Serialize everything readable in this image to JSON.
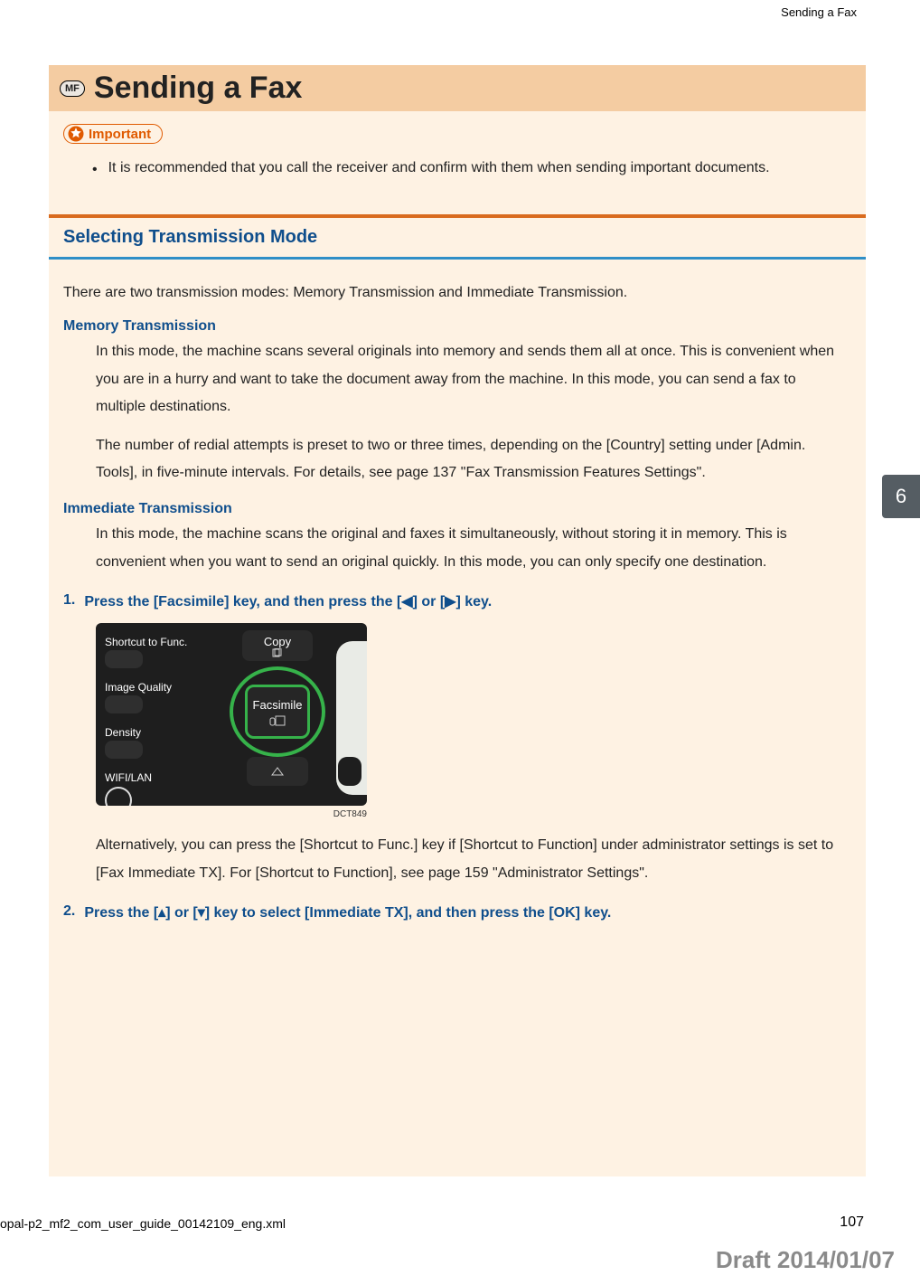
{
  "running_header": "Sending a Fax",
  "chapter_number": "6",
  "mf_badge": "MF",
  "topic_title": "Sending a Fax",
  "important_label": "Important",
  "important_bullets": [
    "It is recommended that you call the receiver and confirm with them when sending important documents."
  ],
  "section_heading": "Selecting Transmission Mode",
  "intro_paragraph": "There are two transmission modes: Memory Transmission and Immediate Transmission.",
  "definitions": [
    {
      "term": "Memory Transmission",
      "paragraphs": [
        "In this mode, the machine scans several originals into memory and sends them all at once. This is convenient when you are in a hurry and want to take the document away from the machine. In this mode, you can send a fax to multiple destinations.",
        "The number of redial attempts is preset to two or three times, depending on the [Country] setting under [Admin. Tools], in five-minute intervals. For details, see page 137 \"Fax Transmission Features Settings\"."
      ]
    },
    {
      "term": "Immediate Transmission",
      "paragraphs": [
        "In this mode, the machine scans the original and faxes it simultaneously, without storing it in memory. This is convenient when you want to send an original quickly. In this mode, you can only specify one destination."
      ]
    }
  ],
  "steps": [
    {
      "num": "1.",
      "text_parts": [
        "Press the [Facsimile] key, and then press the [",
        "◀",
        "] or [",
        "▶",
        "] key."
      ],
      "has_figure": true,
      "after_paragraph": "Alternatively, you can press the [Shortcut to Func.] key if [Shortcut to Function] under administrator settings is set to [Fax Immediate TX]. For [Shortcut to Function], see page 159 \"Administrator Settings\"."
    },
    {
      "num": "2.",
      "text_parts": [
        "Press the [",
        "▴",
        "] or [",
        "▾",
        "] key to select [Immediate TX], and then press the [OK] key."
      ],
      "has_figure": false
    }
  ],
  "panel": {
    "shortcut": "Shortcut to Func.",
    "image_quality": "Image Quality",
    "density": "Density",
    "wifi": "WIFI/LAN",
    "copy": "Copy",
    "facsimile": "Facsimile"
  },
  "figure_code": "DCT849",
  "footer_file": "opal-p2_mf2_com_user_guide_00142109_eng.xml",
  "page_number": "107",
  "draft_stamp": "Draft 2014/01/07"
}
